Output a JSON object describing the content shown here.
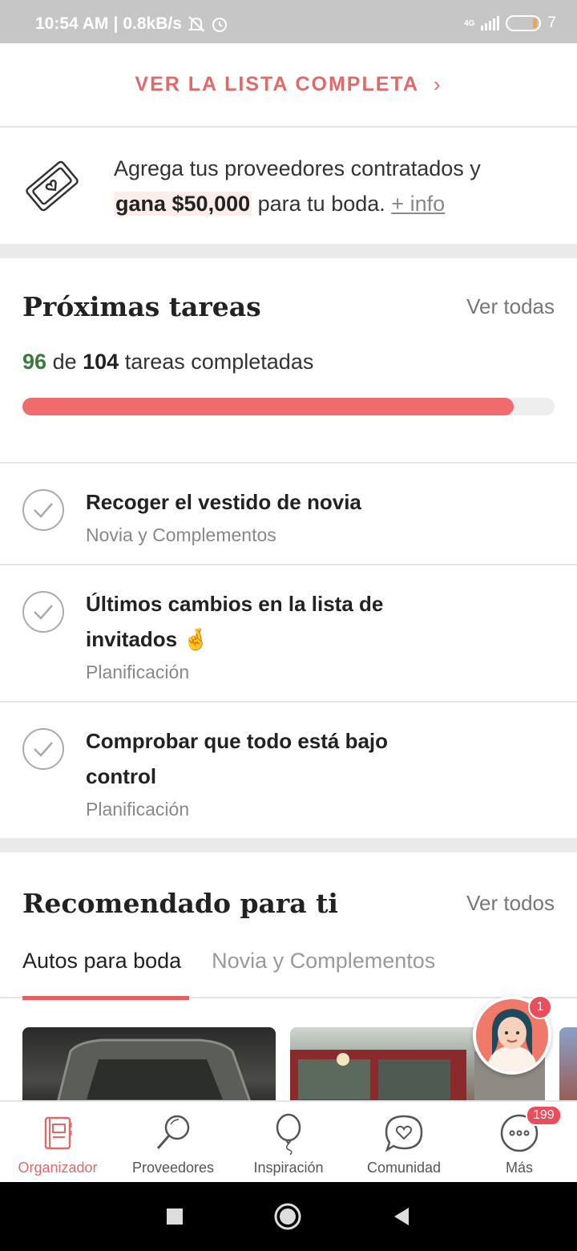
{
  "status_bar": {
    "time": "10:54 AM",
    "speed": "0.8kB/s",
    "network": "4G",
    "battery": "7"
  },
  "full_list": {
    "label": "VER LA LISTA COMPLETA"
  },
  "promo": {
    "text_before": "Agrega tus proveedores contratados y",
    "highlight": "gana $50,000",
    "text_after": "para tu boda.",
    "more_link": "+ info"
  },
  "tasks": {
    "title": "Próximas tareas",
    "see_all": "Ver todas",
    "completed": "96",
    "of_label": "de",
    "total": "104",
    "suffix": "tareas completadas",
    "progress_fraction": 0.923,
    "items": [
      {
        "title": "Recoger el vestido de novia",
        "category": "Novia y Complementos"
      },
      {
        "title": "Últimos cambios en la lista de invitados 🤞",
        "category": "Planificación"
      },
      {
        "title": "Comprobar que todo está bajo control",
        "category": "Planificación"
      }
    ]
  },
  "recommended": {
    "title": "Recomendado para ti",
    "see_all": "Ver todos",
    "tabs": [
      "Autos para boda",
      "Novia y Complementos"
    ],
    "active_tab": 0
  },
  "chat": {
    "badge": "1"
  },
  "bottom_nav": {
    "items": [
      "Organizador",
      "Proveedores",
      "Inspiración",
      "Comunidad",
      "Más"
    ],
    "active": 0,
    "more_badge": "199"
  },
  "colors": {
    "accent": "#e06a6a",
    "progress": "#f06b6b",
    "done_count": "#3b7a3e"
  }
}
